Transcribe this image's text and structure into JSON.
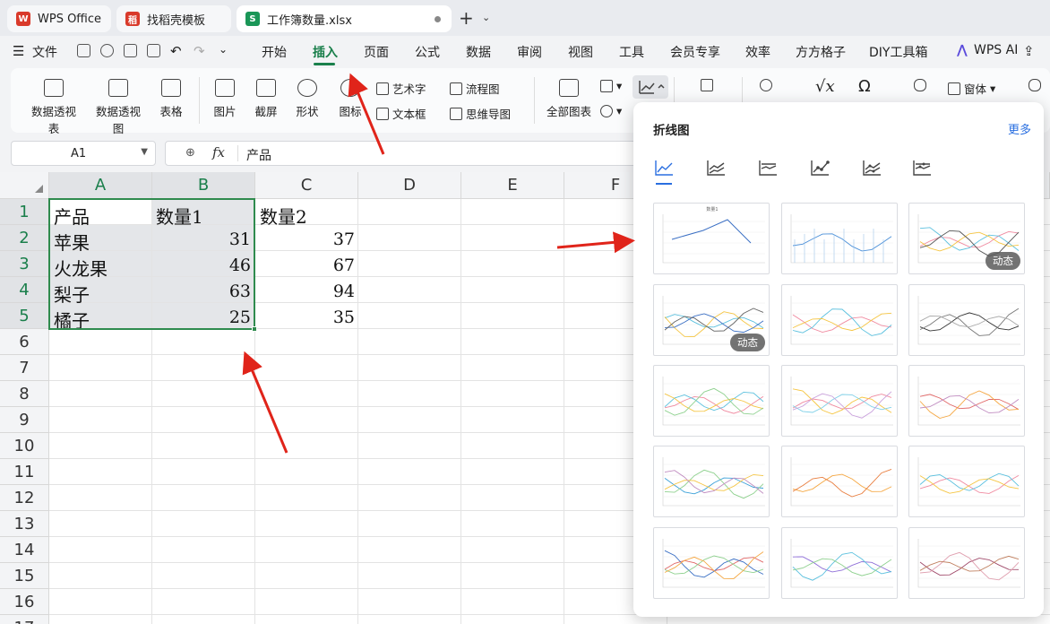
{
  "tabs": [
    {
      "label": "WPS Office",
      "color": "#d93a2b"
    },
    {
      "label": "找稻壳模板",
      "color": "#d93a2b"
    },
    {
      "label": "工作簿数量.xlsx",
      "color": "#1a9657"
    }
  ],
  "menu": {
    "file": "文件",
    "items": [
      "开始",
      "插入",
      "页面",
      "公式",
      "数据",
      "审阅",
      "视图",
      "工具",
      "会员专享",
      "效率",
      "方方格子",
      "DIY工具箱"
    ],
    "active": "插入",
    "wps_ai": "WPS AI"
  },
  "ribbon": {
    "pivot_table": "数据透视表",
    "pivot_chart": "数据透视图",
    "table": "表格",
    "picture": "图片",
    "screenshot": "截屏",
    "shape": "形状",
    "icon": "图标",
    "wordart": "艺术字",
    "textbox": "文本框",
    "flowchart": "流程图",
    "mindmap": "思维导图",
    "all_charts": "全部图表",
    "window": "窗体"
  },
  "namebox": {
    "value": "A1"
  },
  "formula": {
    "value": "产品"
  },
  "grid": {
    "columns": [
      "A",
      "B",
      "C",
      "D",
      "E",
      "F"
    ],
    "rows": [
      "1",
      "2",
      "3",
      "4",
      "5",
      "6",
      "7",
      "8",
      "9",
      "10",
      "11",
      "12",
      "13",
      "14",
      "15",
      "16",
      "17"
    ],
    "header": [
      "产品",
      "数量1",
      "数量2"
    ],
    "data": [
      {
        "name": "苹果",
        "q1": "31",
        "q2": "37"
      },
      {
        "name": "火龙果",
        "q1": "46",
        "q2": "67"
      },
      {
        "name": "梨子",
        "q1": "63",
        "q2": "94"
      },
      {
        "name": "橘子",
        "q1": "25",
        "q2": "35"
      }
    ]
  },
  "panel": {
    "title": "折线图",
    "more": "更多",
    "dynamic_badge": "动态",
    "thumb_titles": [
      "数量1",
      "",
      "",
      "",
      "",
      "",
      "",
      "",
      "",
      "",
      "",
      "",
      "",
      "",
      ""
    ]
  },
  "colors": {
    "accent": "#1a7f4b",
    "selection": "#2f8b4e",
    "link": "#2a6fe0",
    "arrow": "#e0241a"
  }
}
